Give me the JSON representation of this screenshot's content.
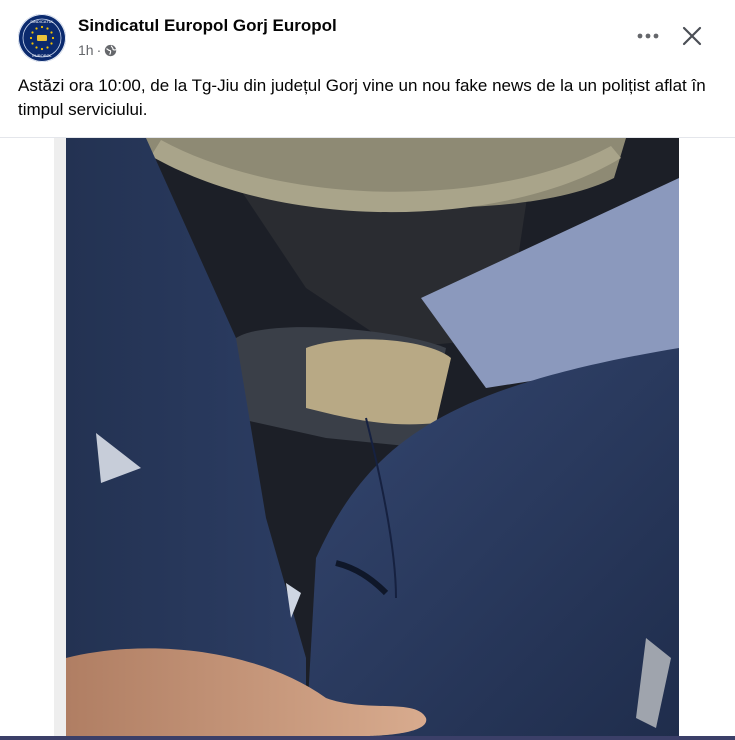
{
  "post": {
    "page_name": "Sindicatul Europol Gorj Europol",
    "time": "1h",
    "separator": "·",
    "privacy_icon": "globe-icon",
    "text": "Astăzi ora 10:00, de la Tg-Jiu din județul Gorj vine un nou fake news de la un polițist aflat în timpul serviciului."
  },
  "actions": {
    "more_icon": "more-horizontal-icon",
    "close_icon": "close-icon"
  },
  "avatar": {
    "top_text": "SINDICATUL",
    "bottom_text": "EUROPOL"
  },
  "colors": {
    "text_primary": "#050505",
    "text_secondary": "#65676b",
    "avatar_bg": "#0b2a6e",
    "divider": "#e4e6eb"
  }
}
